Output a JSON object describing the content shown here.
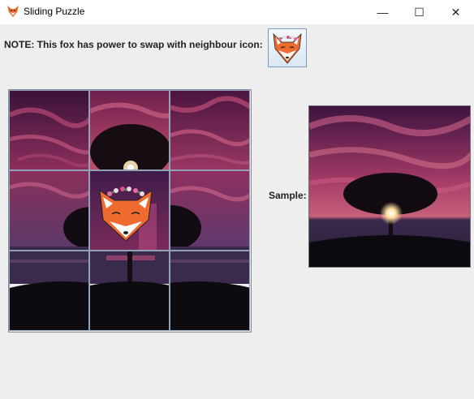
{
  "window": {
    "title": "Sliding Puzzle",
    "controls": {
      "minimize": "—",
      "maximize": "☐",
      "close": "✕"
    }
  },
  "note": "NOTE: This fox has power to swap with neighbour icon:",
  "sample_label": "Sample:",
  "icons": {
    "app": "fox-icon",
    "swap": "fox-flower-crown-icon"
  },
  "puzzle": {
    "rows": 3,
    "cols": 3,
    "fox_tile": "row 2, column 2"
  },
  "colors": {
    "sky_top": "#5a1a4a",
    "sky_mid": "#a73b6a",
    "sea": "#2b1c3a",
    "ground": "#0c0a10",
    "fox_orange": "#ef6a2e"
  }
}
